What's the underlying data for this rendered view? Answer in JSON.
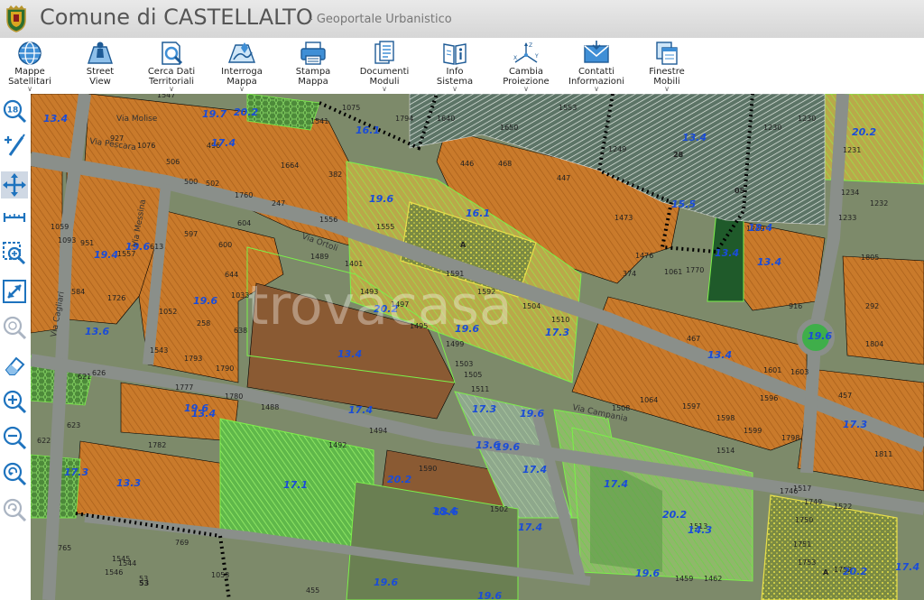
{
  "header": {
    "title": "Comune di CASTELLALTO",
    "subtitle": "- Geoportale Urbanistico"
  },
  "toolbar": [
    {
      "l1": "Mappe",
      "l2": "Satellitari",
      "icon": "globe-icon",
      "chev": "∨"
    },
    {
      "l1": "Street",
      "l2": "View",
      "icon": "map-person-icon",
      "chev": ""
    },
    {
      "l1": "Cerca Dati",
      "l2": "Territoriali",
      "icon": "search-document-icon",
      "chev": "∨"
    },
    {
      "l1": "Interroga",
      "l2": "Mappa",
      "icon": "map-query-icon",
      "chev": "∨"
    },
    {
      "l1": "Stampa",
      "l2": "Mappa",
      "icon": "printer-icon",
      "chev": ""
    },
    {
      "l1": "Documenti",
      "l2": "Moduli",
      "icon": "documents-icon",
      "chev": "∨"
    },
    {
      "l1": "Info",
      "l2": "Sistema",
      "icon": "info-book-icon",
      "chev": "∨"
    },
    {
      "l1": "Cambia",
      "l2": "Proiezione",
      "icon": "projection-axes-icon",
      "chev": "∨"
    },
    {
      "l1": "Contatti",
      "l2": "Informazioni",
      "icon": "envelope-icon",
      "chev": "∨"
    },
    {
      "l1": "Finestre",
      "l2": "Mobili",
      "icon": "windows-icon",
      "chev": "∨"
    }
  ],
  "left_tools": [
    {
      "name": "zoom-level-button",
      "icon": "zoom-level-icon",
      "value": "18"
    },
    {
      "name": "measure-tool-button",
      "icon": "pencil-add-icon",
      "value": ""
    },
    {
      "name": "pan-tool-button",
      "icon": "pan-arrows-icon",
      "value": ""
    },
    {
      "name": "distance-tool-button",
      "icon": "ruler-icon",
      "value": ""
    },
    {
      "name": "zoom-box-button",
      "icon": "zoom-box-icon",
      "value": ""
    },
    {
      "name": "full-extent-button",
      "icon": "expand-diagonal-icon",
      "value": ""
    },
    {
      "name": "zoom-disabled-button",
      "icon": "zoom-grey-icon",
      "value": ""
    },
    {
      "name": "eraser-button",
      "icon": "eraser-icon",
      "value": ""
    },
    {
      "name": "zoom-in-button",
      "icon": "zoom-in-icon",
      "value": ""
    },
    {
      "name": "zoom-out-button",
      "icon": "zoom-out-icon",
      "value": ""
    },
    {
      "name": "zoom-previous-button",
      "icon": "zoom-back-icon",
      "value": ""
    },
    {
      "name": "zoom-next-button",
      "icon": "zoom-forward-icon",
      "value": ""
    }
  ],
  "map": {
    "watermark": "trovacasa",
    "streets": [
      "Via Molise",
      "Via Messina",
      "Via Pescara",
      "Via Campania",
      "Via Cagliari",
      "Via Ortoli"
    ],
    "zones": [
      "13.4",
      "19.7",
      "20.2",
      "17.4",
      "16.1",
      "20.2",
      "13.4",
      "19.6",
      "18.4",
      "16.1",
      "15.5",
      "13.4",
      "13.4",
      "19.4",
      "19.6",
      "19.6",
      "20.2",
      "19.6",
      "17.3",
      "13.6",
      "13.4",
      "19.6",
      "17.4",
      "17.3",
      "19.6",
      "13.6",
      "18.4",
      "13.4",
      "19.6",
      "17.3",
      "13.3",
      "17.1",
      "20.2",
      "13.6",
      "17.4",
      "17.4",
      "20.2",
      "14.3",
      "19.6",
      "13.4",
      "20.2",
      "17.4",
      "19.6",
      "17.4",
      "17.3",
      "19.6",
      "19.6"
    ],
    "parcels": [
      "1547",
      "1541",
      "1075",
      "1794",
      "1640",
      "1650",
      "1553",
      "1230",
      "927",
      "1076",
      "496",
      "1664",
      "382",
      "446",
      "468",
      "447",
      "1249",
      "1230",
      "1231",
      "506",
      "500",
      "502",
      "1760",
      "247",
      "1556",
      "1473",
      "1234",
      "1232",
      "1233",
      "1555",
      "1229",
      "597",
      "600",
      "604",
      "1059",
      "1093",
      "1476",
      "1061",
      "1770",
      "1805",
      "951",
      "1557",
      "613",
      "1489",
      "1401",
      "1591",
      "1592",
      "374",
      "916",
      "584",
      "1726",
      "644",
      "1493",
      "1504",
      "1510",
      "292",
      "1052",
      "258",
      "1033",
      "1497",
      "1495",
      "467",
      "1804",
      "1543",
      "1793",
      "638",
      "1790",
      "1499",
      "1503",
      "1601",
      "1603",
      "1777",
      "1780",
      "1505",
      "1511",
      "1596",
      "457",
      "1064",
      "1597",
      "1598",
      "1599",
      "1798",
      "1811",
      "1782",
      "1488",
      "1494",
      "1508",
      "1514",
      "1492",
      "1590",
      "1502",
      "1517",
      "1522",
      "1746",
      "1749",
      "1750",
      "1751",
      "1753",
      "1752",
      "765",
      "769",
      "1053",
      "455",
      "1513",
      "53",
      "1545",
      "1544",
      "1546",
      "626",
      "621",
      "623",
      "622",
      "1459",
      "1462"
    ],
    "markers": [
      "A",
      "A",
      "05",
      "28",
      "53"
    ]
  }
}
